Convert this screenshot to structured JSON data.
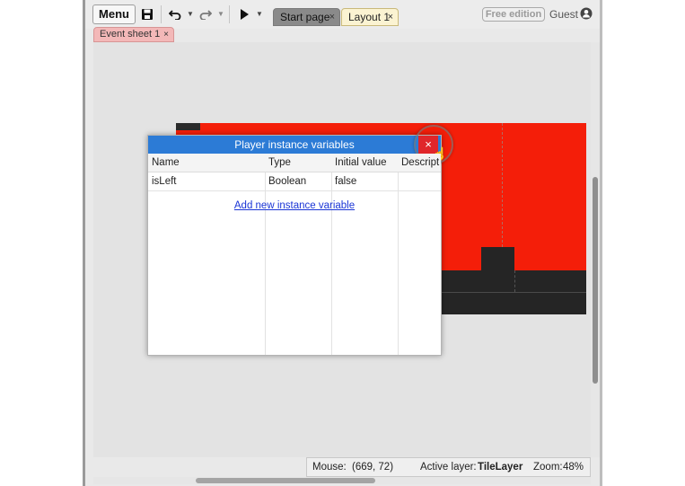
{
  "toolbar": {
    "menu_label": "Menu",
    "icons": [
      "save-icon",
      "undo-icon",
      "redo-icon",
      "play-icon"
    ]
  },
  "tabs": [
    {
      "label": "Start page",
      "close": "×",
      "active": false
    },
    {
      "label": "Layout 1",
      "close": "×",
      "active": true
    }
  ],
  "event_tab": {
    "label": "Event sheet 1",
    "close": "×"
  },
  "account": {
    "edition_badge": "Free edition",
    "user": "Guest"
  },
  "dialog": {
    "title": "Player instance variables",
    "close_label": "×",
    "columns": [
      "Name",
      "Type",
      "Initial value",
      "Descript"
    ],
    "rows": [
      [
        "isLeft",
        "Boolean",
        "false",
        ""
      ]
    ],
    "add_link": "Add new instance variable"
  },
  "statusbar": {
    "mouse_label": "Mouse:",
    "mouse_value": "(669, 72)",
    "layer_label": "Active layer:",
    "layer_value": "TileLayer",
    "zoom_label": "Zoom:",
    "zoom_value": "48%"
  },
  "colors": {
    "layout_background": "#f41e09",
    "tiles": "#252525",
    "dialog_title_bar": "#2c7bd6",
    "close_button": "#e0262a",
    "link": "#1a35d6"
  }
}
